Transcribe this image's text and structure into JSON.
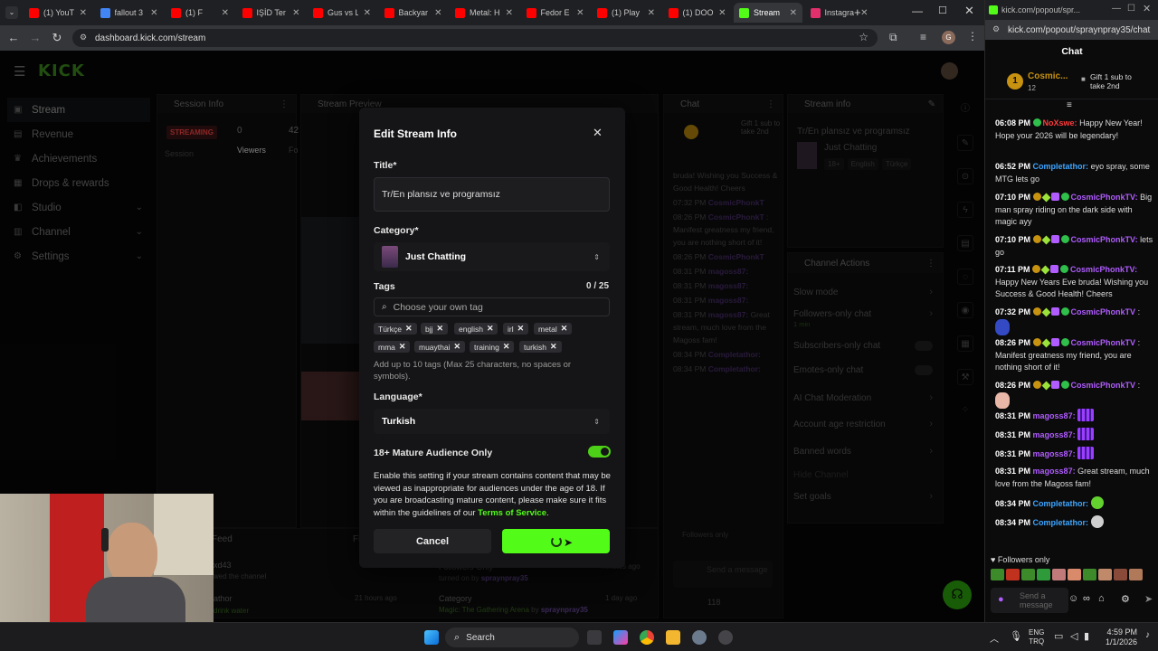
{
  "browser": {
    "tabs": [
      {
        "label": "(1) YouT",
        "color": "#ff0000"
      },
      {
        "label": "fallout 3",
        "color": "#4285f4"
      },
      {
        "label": "(1) F",
        "color": "#ff0000"
      },
      {
        "label": "IŞİD Ter",
        "color": "#ff0000"
      },
      {
        "label": "Gus vs L",
        "color": "#ff0000"
      },
      {
        "label": "Backyar",
        "color": "#ff0000"
      },
      {
        "label": "Metal: H",
        "color": "#ff0000"
      },
      {
        "label": "Fedor E",
        "color": "#ff0000"
      },
      {
        "label": "(1) Play",
        "color": "#ff0000"
      },
      {
        "label": "(1) DOO",
        "color": "#ff0000"
      },
      {
        "label": "Stream",
        "color": "#53fc18",
        "active": true
      },
      {
        "label": "Instagra",
        "color": "#e1306c"
      }
    ],
    "new_tab": "+",
    "url": "dashboard.kick.com/stream",
    "profile_initial": "G"
  },
  "dashboard": {
    "logo": "KICK",
    "sidebar": [
      {
        "label": "Stream",
        "icon": "stream-icon",
        "active": true
      },
      {
        "label": "Revenue",
        "icon": "revenue-icon"
      },
      {
        "label": "Achievements",
        "icon": "trophy-icon"
      },
      {
        "label": "Drops & rewards",
        "icon": "gift-icon"
      },
      {
        "label": "Studio",
        "icon": "studio-icon",
        "chevron": true
      },
      {
        "label": "Channel",
        "icon": "channel-icon",
        "chevron": true
      },
      {
        "label": "Settings",
        "icon": "gear-icon",
        "chevron": true
      }
    ],
    "session": {
      "title": "Session Info",
      "status": "STREAMING",
      "viewers_value": "0",
      "viewers_label": "Viewers",
      "session_label": "Session",
      "followers_value": "42",
      "followers_label": "Fo"
    },
    "preview_title": "Stream Preview",
    "chat_panel": {
      "title": "Chat",
      "gift_text": "Gift 1 sub to take 2nd",
      "lines": [
        {
          "text": "bruda! Wishing you Success & Good Health! Cheers"
        },
        {
          "time": "07:32 PM",
          "user": "CosmicPhonkT"
        },
        {
          "time": "08:26 PM",
          "user": "CosmicPhonkT",
          "text": ": Manifest greatness my friend, you are nothing short of it!"
        },
        {
          "time": "08:26 PM",
          "user": "CosmicPhonkT"
        },
        {
          "time": "08:31 PM",
          "user": "magoss87:"
        },
        {
          "time": "08:31 PM",
          "user": "magoss87:"
        },
        {
          "time": "08:31 PM",
          "user": "magoss87:"
        },
        {
          "time": "08:31 PM",
          "user": "magoss87:",
          "text": "Great stream, much love from the Magoss fam!"
        },
        {
          "time": "08:34 PM",
          "user": "Completathor:"
        },
        {
          "time": "08:34 PM",
          "user": "Completathor:"
        }
      ],
      "followers_only": "Followers only",
      "input_placeholder": "Send a message",
      "viewer_count": "118"
    },
    "stream_info": {
      "title": "Stream info",
      "stream_title": "Tr/En plansız ve programsız",
      "category": "Just Chatting",
      "tags": [
        "18+",
        "English",
        "Türkçe"
      ]
    },
    "channel_actions": {
      "title": "Channel Actions",
      "items": [
        {
          "label": "Slow mode"
        },
        {
          "label": "Followers-only chat",
          "sub": "1 min"
        },
        {
          "label": "Subscribers-only chat"
        },
        {
          "label": "Emotes-only chat"
        },
        {
          "label": "AI Chat Moderation"
        },
        {
          "label": "Account age restriction"
        },
        {
          "label": "Banned words"
        },
        {
          "label": "Hide Channel"
        },
        {
          "label": "Set goals"
        }
      ]
    },
    "feed": {
      "title": "Feed",
      "filter": "Fi",
      "events": [
        {
          "user": "xd43",
          "text": "wed the channel"
        },
        {
          "user": "athor",
          "text": "drink water",
          "time": "21 hours ago"
        }
      ],
      "activity": [
        {
          "title": "Followers-Only",
          "sub": "turned on by",
          "user": "spraynpray35",
          "time": "minutes ago"
        },
        {
          "title": "Category",
          "sub": "Magic: The Gathering Arena",
          "by": "by",
          "user": "spraynpray35",
          "time": "1 day ago"
        }
      ]
    }
  },
  "modal": {
    "title": "Edit Stream Info",
    "title_label": "Title*",
    "title_value": "Tr/En plansız ve programsız",
    "category_label": "Category*",
    "category_value": "Just Chatting",
    "tags_label": "Tags",
    "tags_count": "0 / 25",
    "tags_placeholder": "Choose your own tag",
    "tags": [
      "Türkçe",
      "bjj",
      "english",
      "irl",
      "metal",
      "mma",
      "muaythai",
      "training",
      "turkish"
    ],
    "tags_help": "Add up to 10 tags (Max 25 characters, no spaces or symbols).",
    "language_label": "Language*",
    "language_value": "Turkish",
    "mature_label": "18+ Mature Audience Only",
    "mature_help": "Enable this setting if your stream contains content that may be viewed as inappropriate for audiences under the age of 18. If you are broadcasting mature content, please make sure it fits within the guidelines of our",
    "tos_link": "Terms of Service",
    "tos_end": ".",
    "cancel": "Cancel"
  },
  "popout": {
    "window_title": "kick.com/popout/spr...",
    "url": "kick.com/popout/spraynpray35/chat",
    "heading": "Chat",
    "pinned_user": "Cosmic...",
    "pinned_count": "12",
    "pinned_gift": "Gift 1 sub to take 2nd",
    "messages": [
      {
        "time": "06:08 PM",
        "user": "NoXswe:",
        "color": "#ff3b3b",
        "text": "Happy New Year! Hope your 2026 will be legendary!"
      },
      {
        "time": "06:52 PM",
        "user": "Completathor:",
        "color": "#3ea6ff",
        "text": "eyo spray, some MTG lets go"
      },
      {
        "time": "07:10 PM",
        "user": "CosmicPhonkTV:",
        "color": "#b05cff",
        "text": "Big man spray riding on the dark side with magic ayy"
      },
      {
        "time": "07:10 PM",
        "user": "CosmicPhonkTV:",
        "color": "#b05cff",
        "text": "lets go"
      },
      {
        "time": "07:11 PM",
        "user": "CosmicPhonkTV:",
        "color": "#b05cff",
        "text": "Happy New Years Eve bruda! Wishing you Success & Good Health! Cheers"
      },
      {
        "time": "07:32 PM",
        "user": "CosmicPhonkTV",
        "color": "#b05cff",
        "text": ":"
      },
      {
        "time": "08:26 PM",
        "user": "CosmicPhonkTV",
        "color": "#b05cff",
        "text": ": Manifest greatness my friend, you are nothing short of it!"
      },
      {
        "time": "08:26 PM",
        "user": "CosmicPhonkTV",
        "color": "#b05cff",
        "text": ":"
      },
      {
        "time": "08:31 PM",
        "user": "magoss87:",
        "color": "#b05cff",
        "text": ""
      },
      {
        "time": "08:31 PM",
        "user": "magoss87:",
        "color": "#b05cff",
        "text": ""
      },
      {
        "time": "08:31 PM",
        "user": "magoss87:",
        "color": "#b05cff",
        "text": ""
      },
      {
        "time": "08:31 PM",
        "user": "magoss87:",
        "color": "#b05cff",
        "text": "Great stream, much love from the Magoss fam!"
      },
      {
        "time": "08:34 PM",
        "user": "Completathor:",
        "color": "#3ea6ff",
        "text": ""
      },
      {
        "time": "08:34 PM",
        "user": "Completathor:",
        "color": "#3ea6ff",
        "text": ""
      }
    ],
    "followers_only": "Followers only",
    "input_placeholder": "Send a message"
  },
  "taskbar": {
    "search": "Search",
    "lang_top": "ENG",
    "lang_bottom": "TRQ",
    "time": "4:59 PM",
    "date": "1/1/2026"
  },
  "accent": "#53fc18"
}
